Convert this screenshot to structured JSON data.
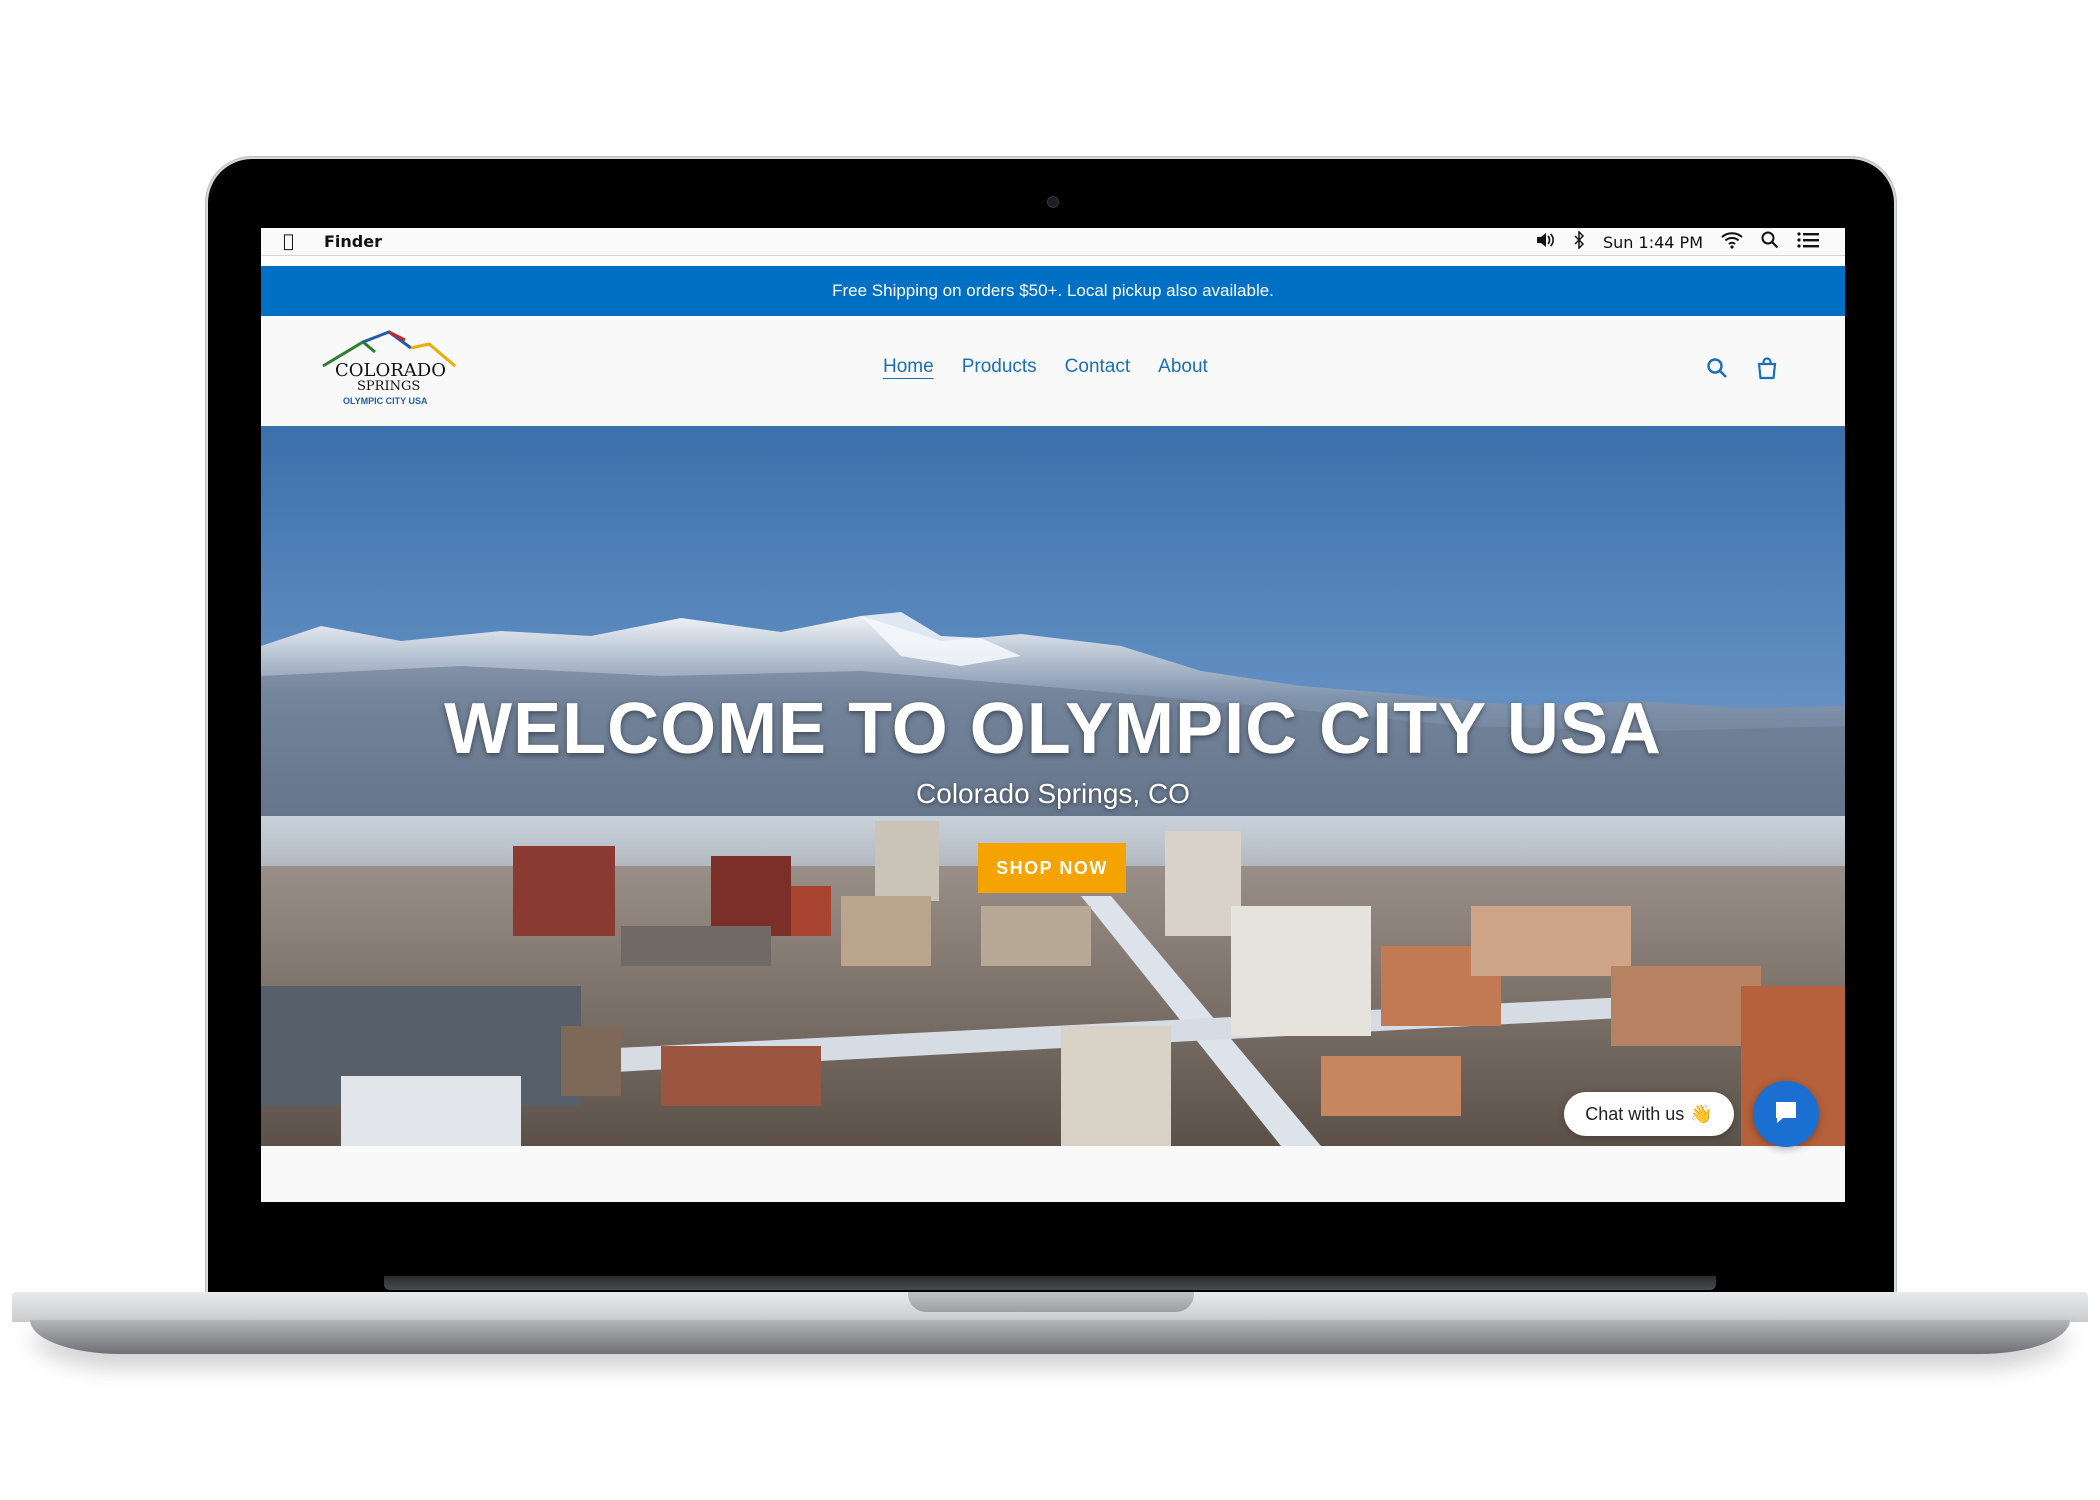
{
  "menubar": {
    "app_name": "Finder",
    "clock": "Sun 1:44 PM",
    "icons": [
      "apple-icon",
      "volume-icon",
      "bluetooth-icon",
      "wifi-icon",
      "spotlight-search-icon",
      "control-center-icon"
    ]
  },
  "announcement": "Free Shipping on orders $50+. Local pickup also available.",
  "logo": {
    "line1": "COLORADO",
    "line2": "SPRINGS",
    "line3": "OLYMPIC CITY USA"
  },
  "nav": {
    "items": [
      {
        "label": "Home",
        "active": true
      },
      {
        "label": "Products",
        "active": false
      },
      {
        "label": "Contact",
        "active": false
      },
      {
        "label": "About",
        "active": false
      }
    ]
  },
  "hero": {
    "title": "WELCOME TO OLYMPIC CITY USA",
    "subtitle": "Colorado Springs, CO",
    "button": "SHOP NOW"
  },
  "chat": {
    "label": "Chat with us",
    "emoji": "👋"
  },
  "colors": {
    "announcement_bg": "#0070c4",
    "link": "#1a6fb8",
    "button": "#f5a300",
    "chat_button": "#1b6fd0"
  }
}
